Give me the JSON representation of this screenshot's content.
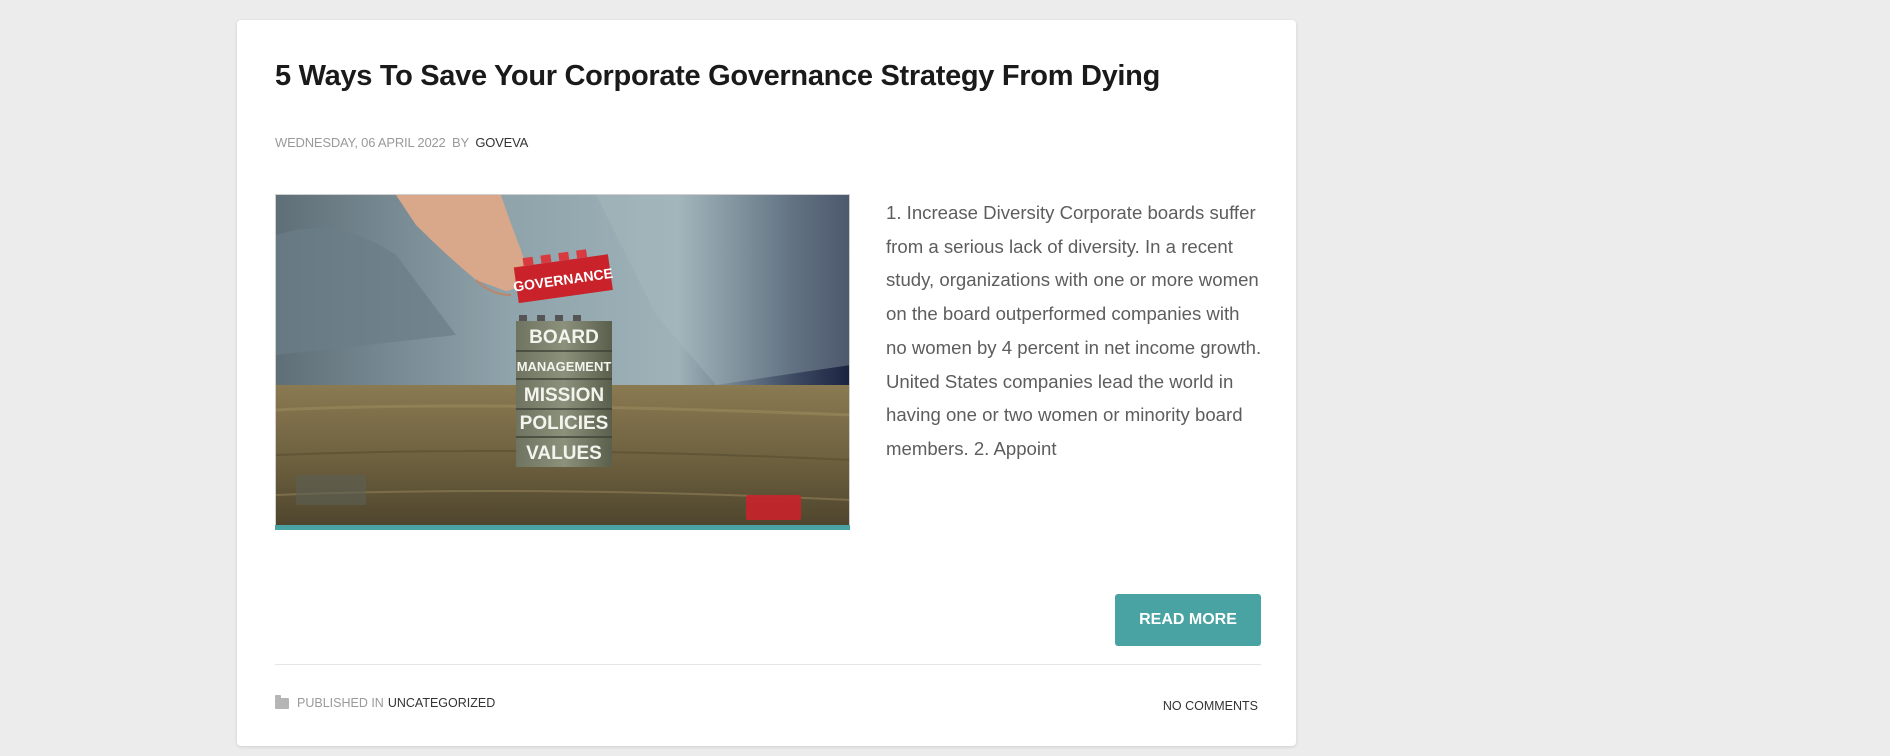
{
  "post": {
    "title": "5 Ways To Save Your Corporate Governance Strategy From Dying",
    "meta": {
      "date": "WEDNESDAY, 06 APRIL 2022",
      "by_label": "BY",
      "author": "GOVEVA"
    },
    "image": {
      "blocks": [
        "GOVERNANCE",
        "BOARD",
        "MANAGEMENT",
        "MISSION",
        "POLICIES",
        "VALUES"
      ]
    },
    "excerpt": "1. Increase Diversity Corporate boards suffer from a serious lack of diversity. In a recent study, organizations with one or more women on the board outperformed companies with no women by 4 percent in net income growth. United States companies lead the world in having one or two women or minority board members. 2. Appoint",
    "read_more_label": "READ MORE",
    "footer": {
      "published_label": "PUBLISHED IN",
      "category": "UNCATEGORIZED",
      "comments": "NO COMMENTS"
    }
  },
  "colors": {
    "accent": "#4aa3a3",
    "background": "#ececec",
    "card": "#ffffff",
    "title": "#1a1a1a"
  },
  "icons": {
    "footer_category": "folder-icon"
  }
}
